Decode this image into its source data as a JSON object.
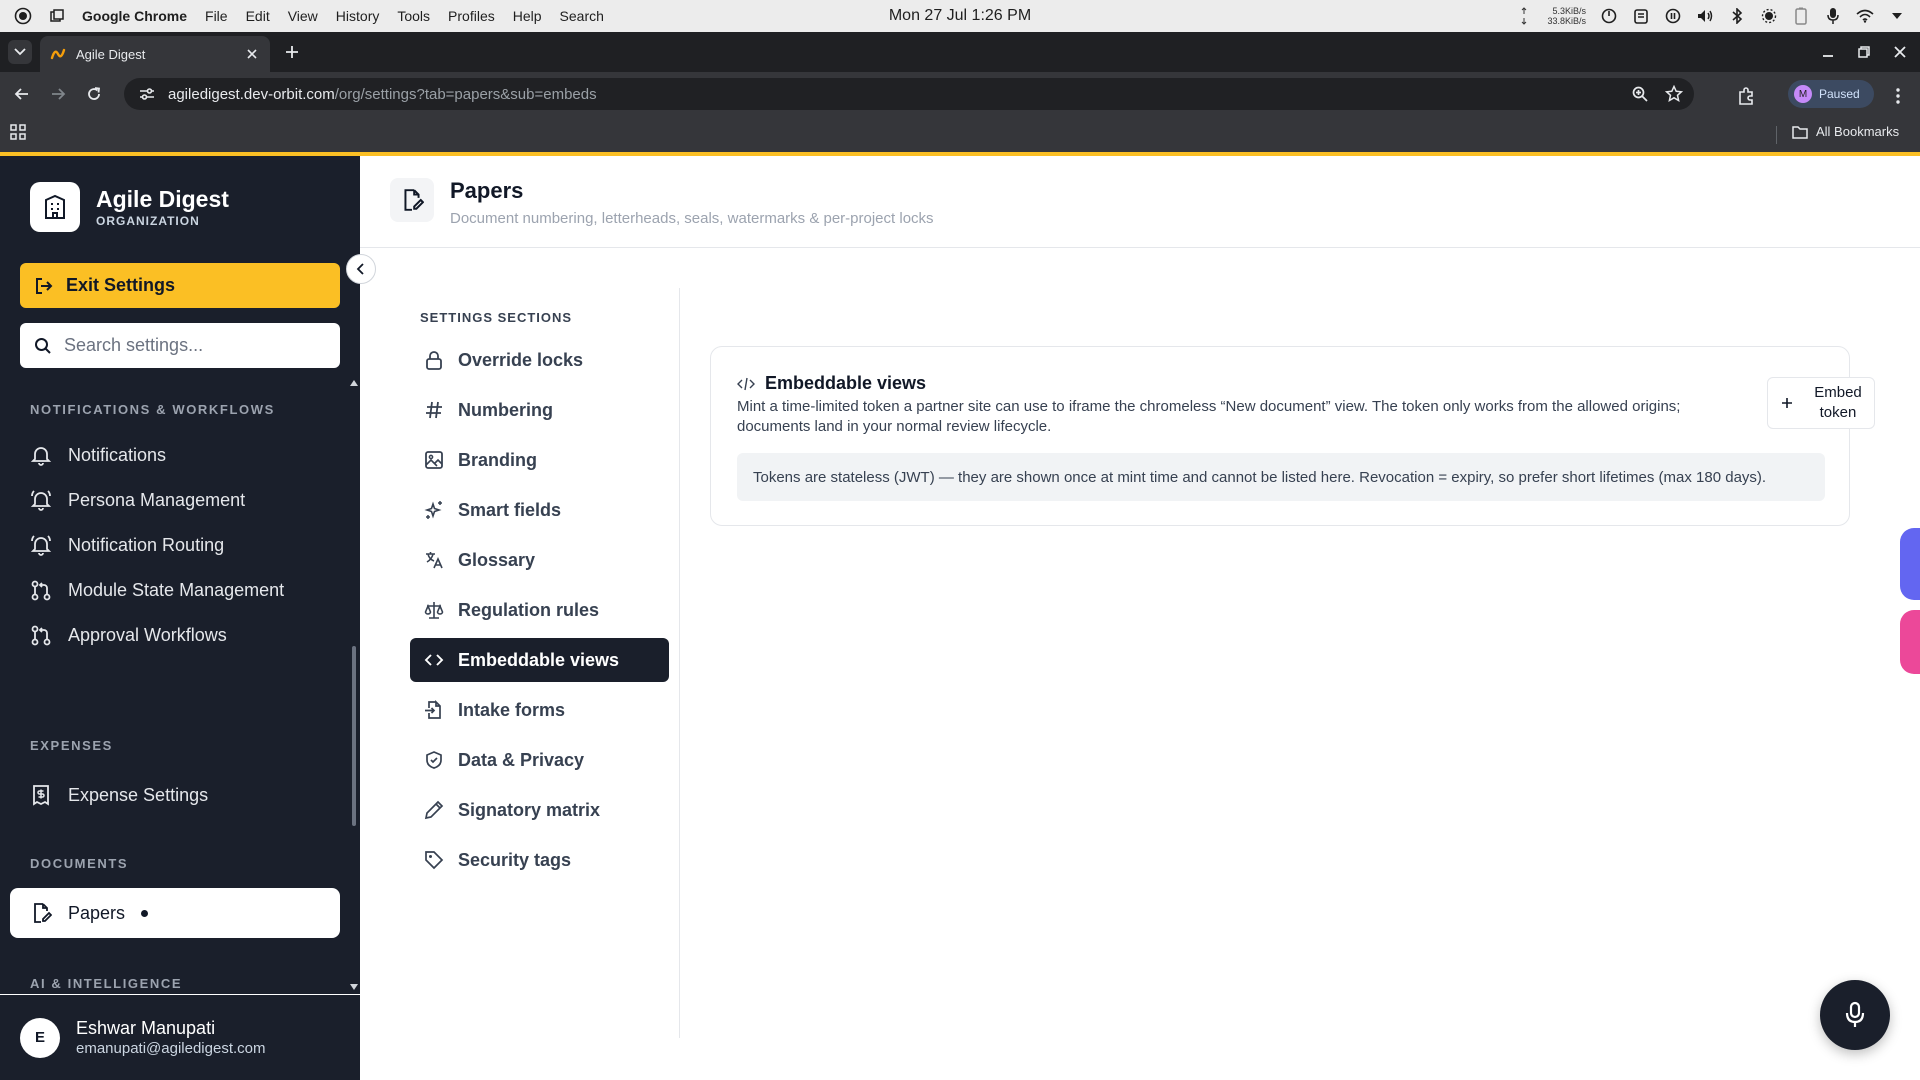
{
  "os": {
    "app_name": "Google Chrome",
    "menu": [
      "File",
      "Edit",
      "View",
      "History",
      "Tools",
      "Profiles",
      "Help",
      "Search"
    ],
    "clock": "Mon 27 Jul  1:26 PM",
    "net_up": "5.3KiB/s",
    "net_down": "33.8KiB/s",
    "tray_icons": [
      "arrow-up-down-icon",
      "power-icon",
      "clipboard-icon",
      "pause-icon",
      "volume-icon",
      "bluetooth-icon",
      "brightness-icon",
      "battery-icon",
      "microphone-icon",
      "wifi-icon",
      "chevron-down-icon"
    ]
  },
  "browser": {
    "tab_title": "Agile Digest",
    "url_host": "agiledigest.dev-orbit.com",
    "url_path": "/org/settings?tab=papers&sub=embeds",
    "profile_initial": "M",
    "profile_status": "Paused",
    "all_bookmarks": "All Bookmarks"
  },
  "sidebar": {
    "org_name": "Agile Digest",
    "org_type": "ORGANIZATION",
    "exit_label": "Exit Settings",
    "search_placeholder": "Search settings...",
    "groups": [
      {
        "label": "NOTIFICATIONS & WORKFLOWS",
        "items": [
          "Notifications",
          "Persona Management",
          "Notification Routing",
          "Module State Management",
          "Approval Workflows"
        ]
      },
      {
        "label": "EXPENSES",
        "items": [
          "Expense Settings"
        ]
      },
      {
        "label": "DOCUMENTS",
        "items": [
          "Papers"
        ]
      },
      {
        "label": "AI & INTELLIGENCE",
        "items": []
      }
    ],
    "active_item": "Papers",
    "user": {
      "initial": "E",
      "name": "Eshwar Manupati",
      "email": "emanupati@agiledigest.com"
    }
  },
  "page": {
    "title": "Papers",
    "subtitle": "Document numbering, letterheads, seals, watermarks & per-project locks"
  },
  "sections": {
    "label": "SETTINGS SECTIONS",
    "items": [
      "Override locks",
      "Numbering",
      "Branding",
      "Smart fields",
      "Glossary",
      "Regulation rules",
      "Embeddable views",
      "Intake forms",
      "Data & Privacy",
      "Signatory matrix",
      "Security tags"
    ],
    "active": "Embeddable views"
  },
  "card": {
    "title": "Embeddable views",
    "description": "Mint a time-limited token a partner site can use to iframe the chromeless “New document” view. The token only works from the allowed origins; documents land in your normal review lifecycle.",
    "button_line1": "Embed",
    "button_line2": "token",
    "note": "Tokens are stateless (JWT) — they are shown once at mint time and cannot be listed here. Revocation = expiry, so prefer short lifetimes (max 180 days)."
  },
  "colors": {
    "accent": "#fbbf24",
    "sidebar_bg": "#1a1f2b",
    "active_section_bg": "#1a1f2b",
    "side_tab_purple": "#6366f1",
    "side_tab_pink": "#ec4899"
  }
}
